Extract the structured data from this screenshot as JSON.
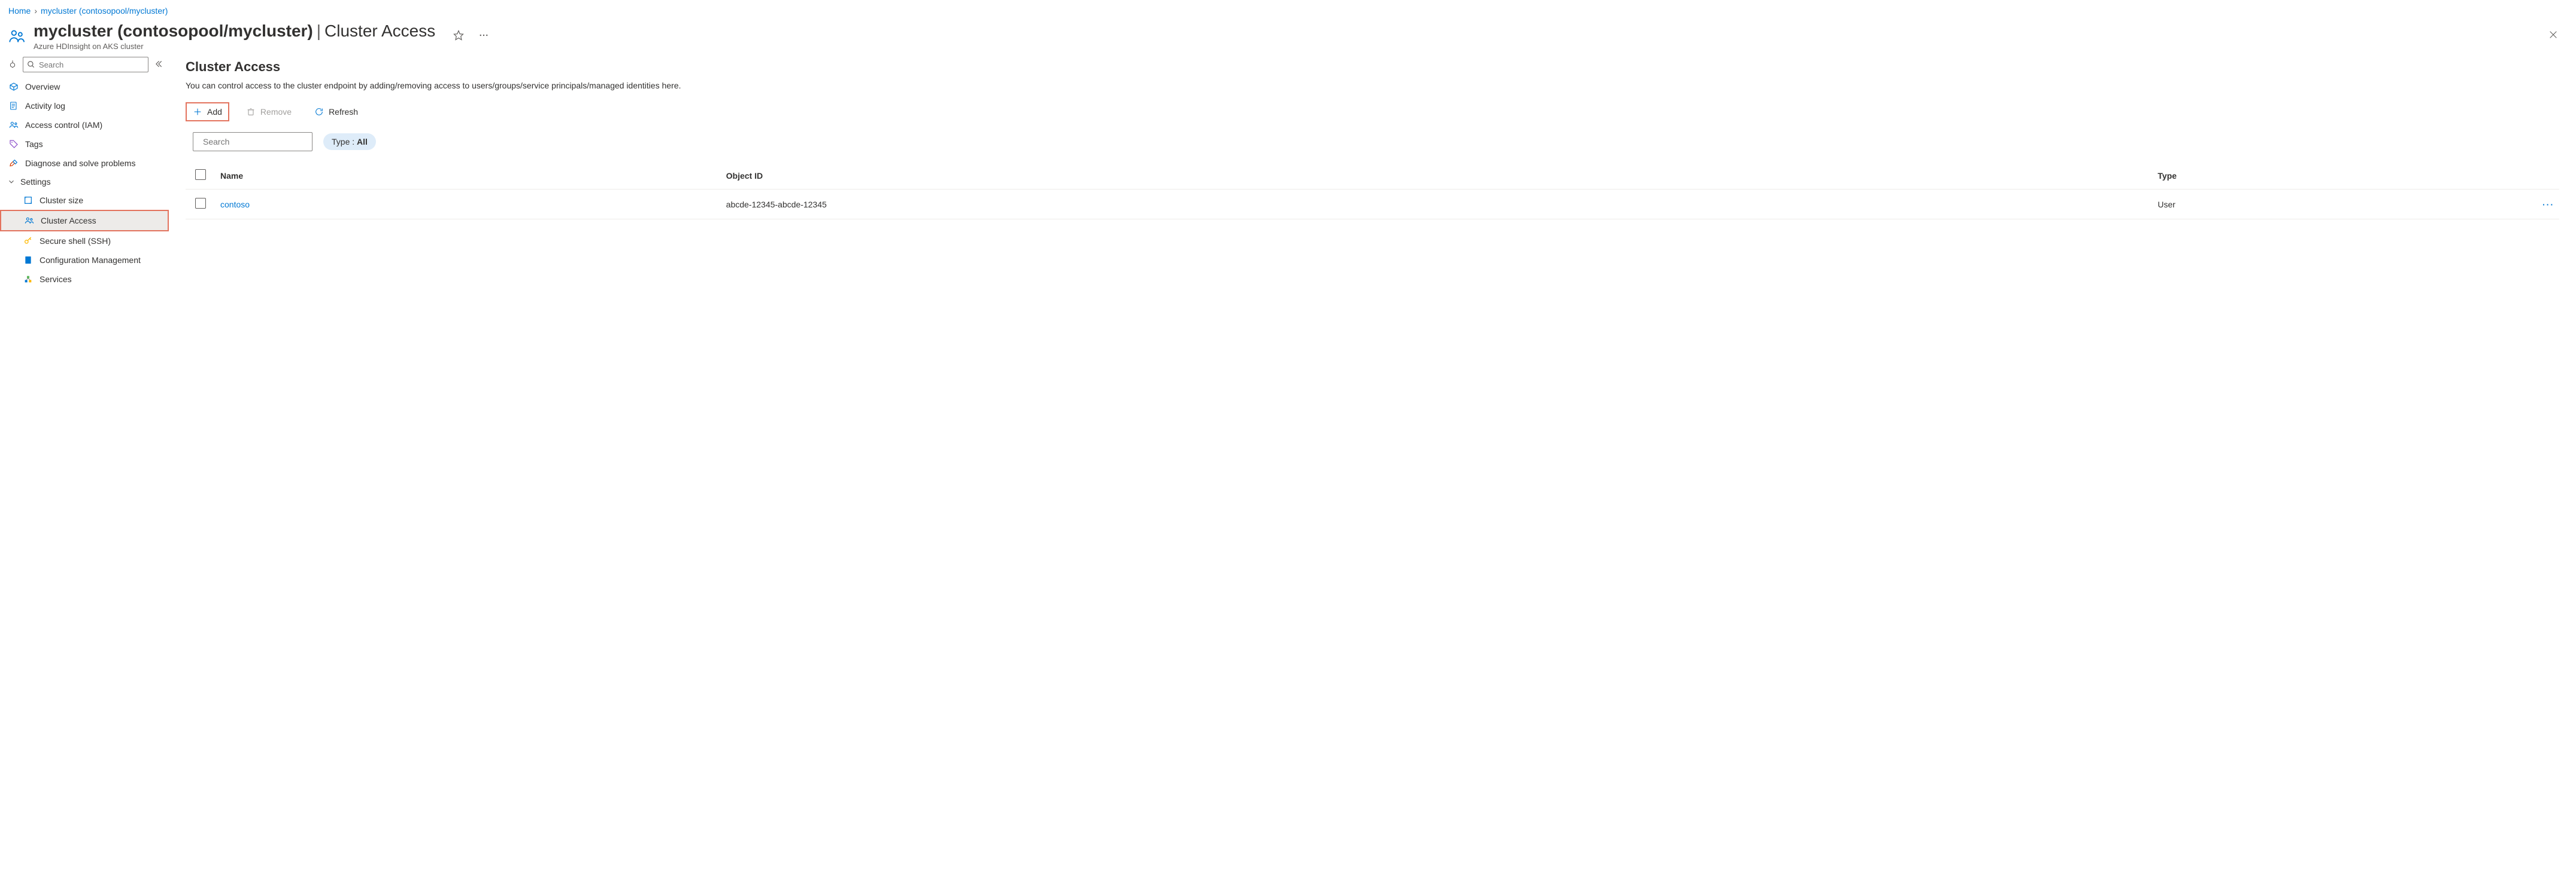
{
  "breadcrumb": {
    "home": "Home",
    "current": "mycluster (contosopool/mycluster)"
  },
  "header": {
    "resource_name": "mycluster (contosopool/mycluster)",
    "separator": "|",
    "blade_name": "Cluster Access",
    "subtitle": "Azure HDInsight on AKS cluster"
  },
  "sidebar": {
    "search_placeholder": "Search",
    "items": {
      "overview": "Overview",
      "activity_log": "Activity log",
      "iam": "Access control (IAM)",
      "tags": "Tags",
      "diagnose": "Diagnose and solve problems"
    },
    "settings_group": "Settings",
    "settings": {
      "cluster_size": "Cluster size",
      "cluster_access": "Cluster Access",
      "ssh": "Secure shell (SSH)",
      "config": "Configuration Management",
      "services": "Services"
    }
  },
  "main": {
    "title": "Cluster Access",
    "description": "You can control access to the cluster endpoint by adding/removing access to users/groups/service principals/managed identities here.",
    "toolbar": {
      "add": "Add",
      "remove": "Remove",
      "refresh": "Refresh"
    },
    "filter": {
      "search_placeholder": "Search",
      "type_label": "Type : ",
      "type_value": "All"
    },
    "table": {
      "col_name": "Name",
      "col_object_id": "Object ID",
      "col_type": "Type",
      "rows": [
        {
          "name": "contoso",
          "object_id": "abcde-12345-abcde-12345",
          "type": "User"
        }
      ]
    }
  }
}
